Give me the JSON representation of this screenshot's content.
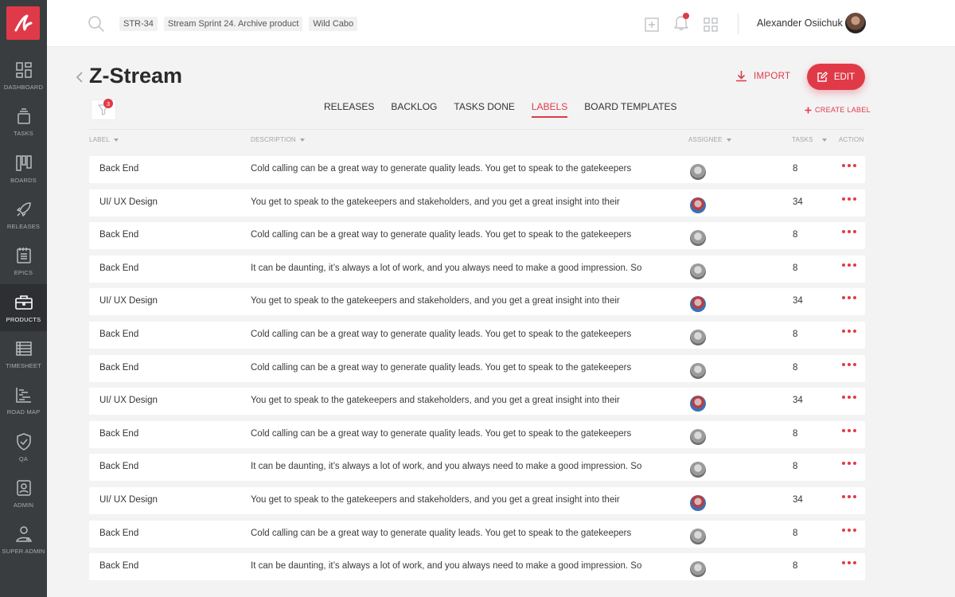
{
  "sidebar": {
    "items": [
      {
        "label": "DASHBOARD",
        "icon": "dashboard-icon"
      },
      {
        "label": "TASKS",
        "icon": "tasks-icon"
      },
      {
        "label": "BOARDS",
        "icon": "boards-icon"
      },
      {
        "label": "RELEASES",
        "icon": "rocket-icon"
      },
      {
        "label": "EPICS",
        "icon": "epics-icon"
      },
      {
        "label": "PRODUCTS",
        "icon": "briefcase-icon",
        "active": true
      },
      {
        "label": "TIMESHEET",
        "icon": "timesheet-icon"
      },
      {
        "label": "ROAD MAP",
        "icon": "roadmap-icon"
      },
      {
        "label": "QA",
        "icon": "shield-check-icon"
      },
      {
        "label": "ADMIN",
        "icon": "admin-icon"
      },
      {
        "label": "SUPER ADMIN",
        "icon": "super-admin-icon"
      }
    ]
  },
  "topbar": {
    "breadcrumbs": [
      "STR-34",
      "Stream Sprint 24. Archive product",
      "Wild Cabo"
    ],
    "username": "Alexander Osiichuk"
  },
  "header": {
    "title": "Z-Stream",
    "import_label": "IMPORT",
    "edit_label": "EDIT",
    "filter_count": "3",
    "create_label": "CREATE LABEL",
    "tabs": [
      {
        "label": "RELEASES"
      },
      {
        "label": "BACKLOG"
      },
      {
        "label": "TASKS DONE"
      },
      {
        "label": "LABELS",
        "active": true
      },
      {
        "label": "BOARD TEMPLATES"
      }
    ]
  },
  "table": {
    "columns": {
      "label": "LABEL",
      "description": "DESCRIPTION",
      "assignee": "ASSIGNEE",
      "tasks": "TASKS",
      "action": "ACTION"
    },
    "rows": [
      {
        "label": "Back End",
        "description": "Cold calling can be a great way to generate quality leads. You get to speak to the gatekeepers",
        "avatar": "grey",
        "tasks": "8"
      },
      {
        "label": "UI/ UX Design",
        "description": "You get to speak to the gatekeepers and stakeholders, and you get a great insight into their",
        "avatar": "color",
        "tasks": "34"
      },
      {
        "label": "Back End",
        "description": "Cold calling can be a great way to generate quality leads. You get to speak to the gatekeepers",
        "avatar": "grey",
        "tasks": "8"
      },
      {
        "label": "Back End",
        "description": "It can be daunting, it’s always a lot of work, and you always need to make a good impression. So",
        "avatar": "grey",
        "tasks": "8"
      },
      {
        "label": "UI/ UX Design",
        "description": "You get to speak to the gatekeepers and stakeholders, and you get a great insight into their",
        "avatar": "color",
        "tasks": "34"
      },
      {
        "label": "Back End",
        "description": "Cold calling can be a great way to generate quality leads. You get to speak to the gatekeepers",
        "avatar": "grey",
        "tasks": "8"
      },
      {
        "label": "Back End",
        "description": "Cold calling can be a great way to generate quality leads. You get to speak to the gatekeepers",
        "avatar": "grey",
        "tasks": "8"
      },
      {
        "label": "UI/ UX Design",
        "description": "You get to speak to the gatekeepers and stakeholders, and you get a great insight into their",
        "avatar": "color",
        "tasks": "34"
      },
      {
        "label": "Back End",
        "description": "Cold calling can be a great way to generate quality leads. You get to speak to the gatekeepers",
        "avatar": "grey",
        "tasks": "8"
      },
      {
        "label": "Back End",
        "description": "It can be daunting, it’s always a lot of work, and you always need to make a good impression. So",
        "avatar": "grey",
        "tasks": "8"
      },
      {
        "label": "UI/ UX Design",
        "description": "You get to speak to the gatekeepers and stakeholders, and you get a great insight into their",
        "avatar": "color",
        "tasks": "34"
      },
      {
        "label": "Back End",
        "description": "Cold calling can be a great way to generate quality leads. You get to speak to the gatekeepers",
        "avatar": "grey",
        "tasks": "8"
      },
      {
        "label": "Back End",
        "description": "It can be daunting, it’s always a lot of work, and you always need to make a good impression. So",
        "avatar": "grey",
        "tasks": "8"
      }
    ]
  },
  "colors": {
    "accent": "#e03a48",
    "sidebar_bg": "#3a3d40",
    "sidebar_active_bg": "#2d2f32",
    "page_bg": "#f3f3f4"
  }
}
